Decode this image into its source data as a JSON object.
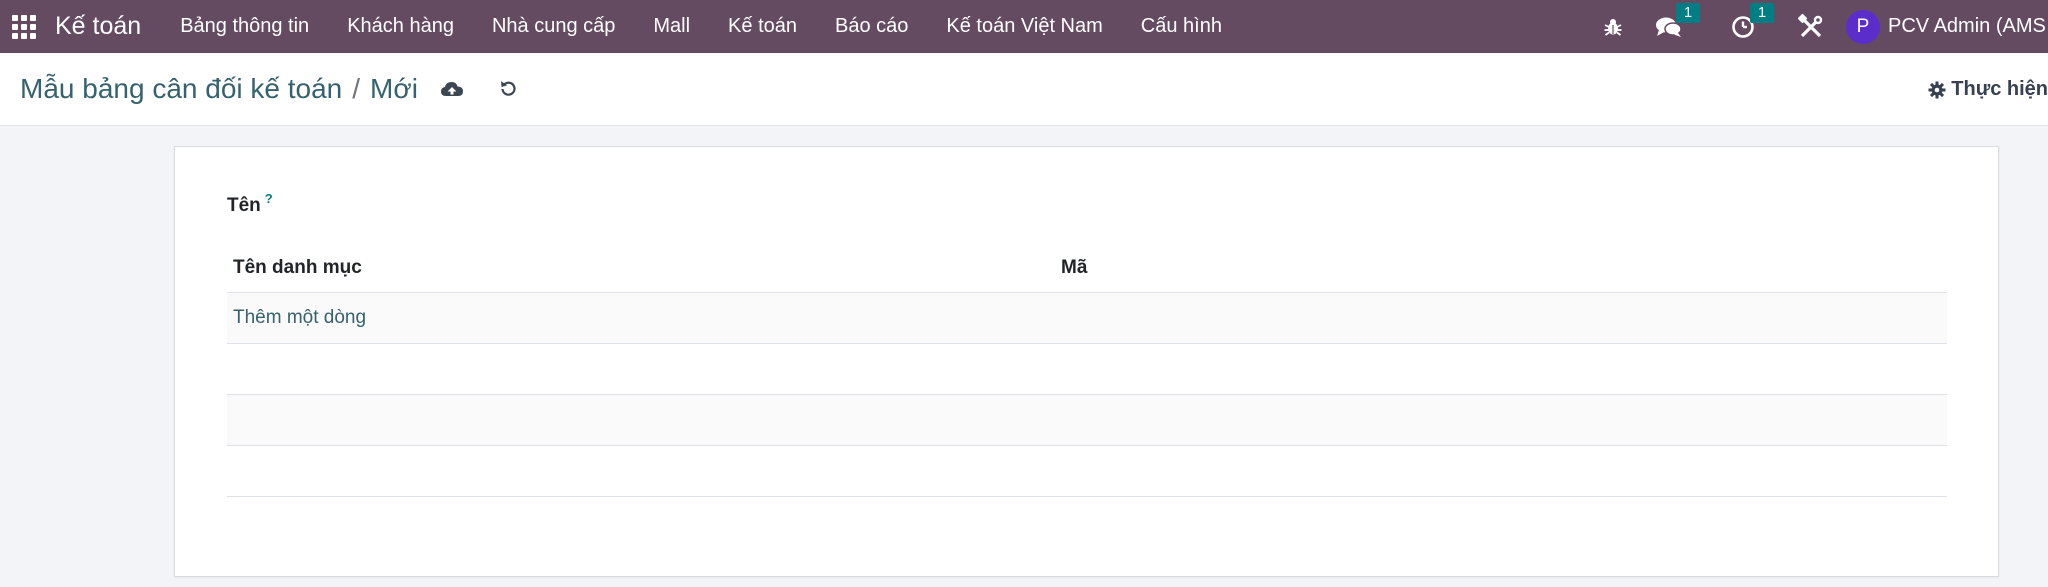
{
  "navbar": {
    "brand": "Kế toán",
    "menu": [
      "Bảng thông tin",
      "Khách hàng",
      "Nhà cung cấp",
      "Mall",
      "Kế toán",
      "Báo cáo",
      "Kế toán Việt Nam",
      "Cấu hình"
    ],
    "messages_count": "1",
    "activities_count": "1",
    "user_initial": "P",
    "user_name": "PCV Admin (AMS"
  },
  "control_panel": {
    "breadcrumb_parent": "Mẫu bảng cân đối kế toán",
    "breadcrumb_sep": "/",
    "breadcrumb_current": "Mới",
    "action_label": "Thực hiện"
  },
  "form": {
    "name_label": "Tên",
    "name_help": "?",
    "name_value": "",
    "list": {
      "columns": [
        "Tên danh mục",
        "Mã"
      ],
      "add_line_label": "Thêm một dòng"
    }
  },
  "colors": {
    "navbar": "#644b61",
    "link": "#35626e",
    "badge": "#017e84",
    "avatar": "#5b2ecc"
  }
}
